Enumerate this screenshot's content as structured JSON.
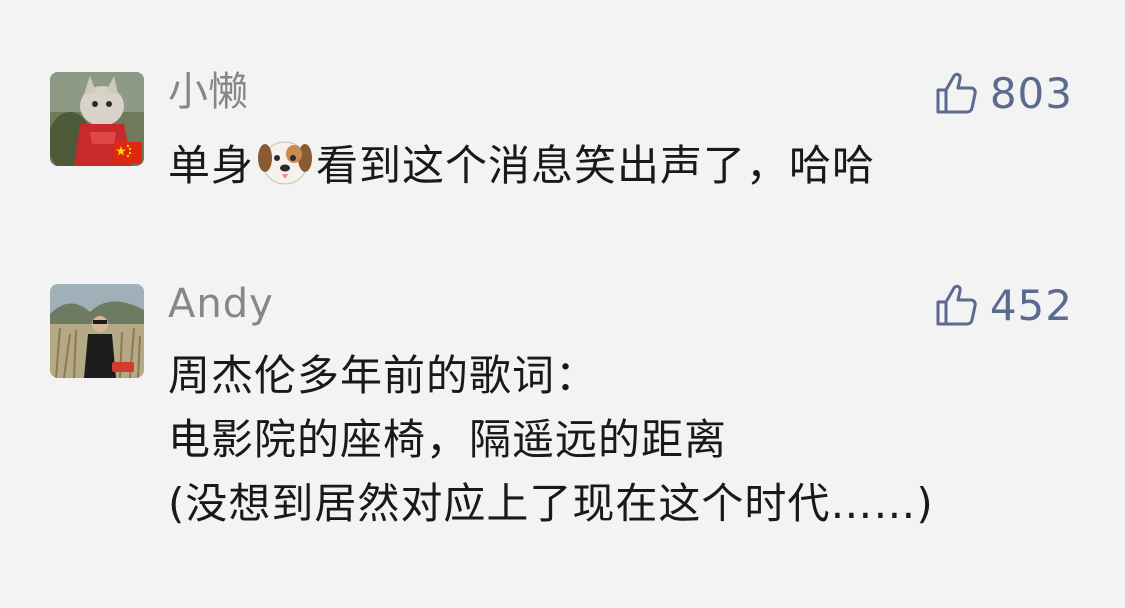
{
  "comments": [
    {
      "username": "小懒",
      "likes": "803",
      "text_before_emoji": "单身",
      "emoji": "dog-face-emoji",
      "text_after_emoji": "看到这个消息笑出声了，哈哈",
      "avatar_badge": "china-flag-icon"
    },
    {
      "username": "Andy",
      "likes": "452",
      "lines": [
        "周杰伦多年前的歌词：",
        "电影院的座椅，隔遥远的距离",
        "(没想到居然对应上了现在这个时代……)"
      ]
    }
  ],
  "colors": {
    "background": "#f3f3f3",
    "username": "#878787",
    "text": "#191919",
    "like": "#5b6a8f"
  }
}
